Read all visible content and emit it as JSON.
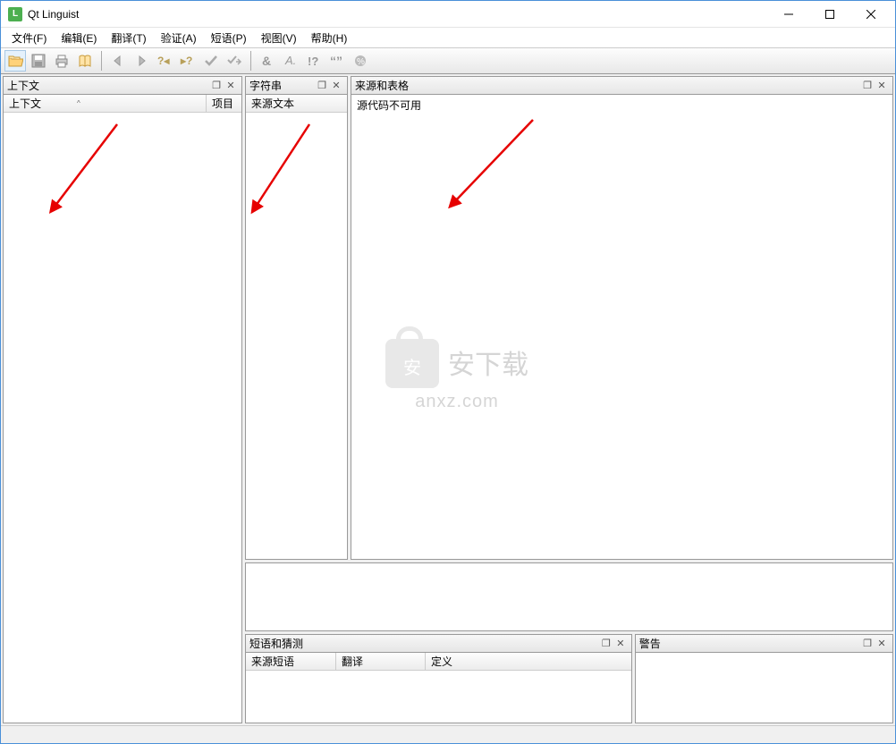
{
  "titlebar": {
    "app_icon_letter": "L",
    "title": "Qt Linguist"
  },
  "menu": {
    "file": "文件(F)",
    "edit": "编辑(E)",
    "translate": "翻译(T)",
    "validate": "验证(A)",
    "phrases": "短语(P)",
    "view": "视图(V)",
    "help": "帮助(H)"
  },
  "panels": {
    "context": {
      "title": "上下文",
      "col_context": "上下文",
      "col_items": "项目"
    },
    "strings": {
      "title": "字符串",
      "col_source": "来源文本"
    },
    "source_forms": {
      "title": "来源和表格",
      "body_text": "源代码不可用"
    },
    "phrases_guesses": {
      "title": "短语和猜测",
      "col_source_phrase": "来源短语",
      "col_translation": "翻译",
      "col_definition": "定义"
    },
    "warnings": {
      "title": "警告"
    }
  },
  "watermark": {
    "badge_char": "安",
    "text_main": "安下载",
    "text_url": "anxz.com"
  }
}
